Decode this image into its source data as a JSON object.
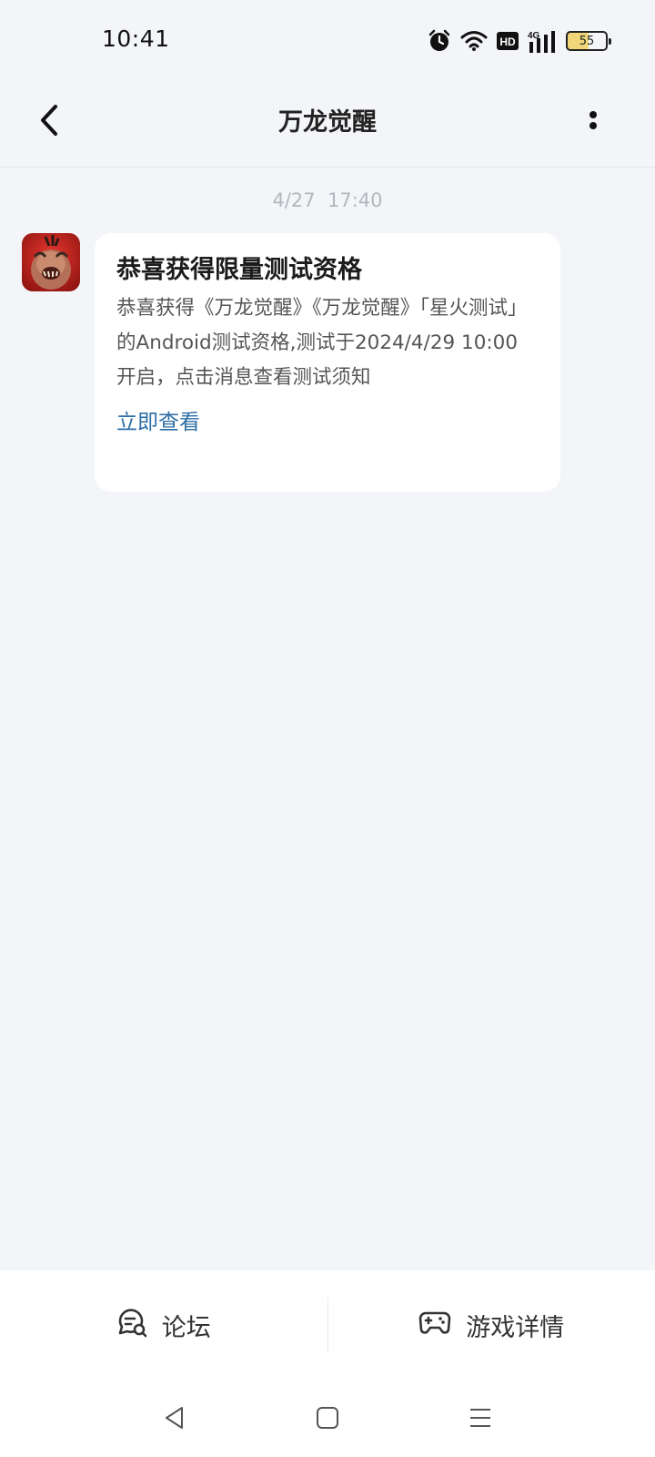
{
  "status_bar": {
    "time": "10:41",
    "battery_level": "55",
    "network_label": "4G",
    "hd_label": "HD",
    "icons": [
      "alarm-icon",
      "wifi-icon",
      "hd-icon",
      "signal-icon",
      "battery-icon"
    ]
  },
  "header": {
    "title": "万龙觉醒",
    "back_icon": "back-arrow-icon",
    "more_icon": "more-vertical-icon"
  },
  "message": {
    "timestamp": "4/27  17:40",
    "title": "恭喜获得限量测试资格",
    "body": "恭喜获得《万龙觉醒》《万龙觉醒》「星火测试」的Android测试资格,测试于2024/4/29 10:00 开启，点击消息查看测试须知",
    "link_label": "立即查看",
    "link_color": "#2d6ea6"
  },
  "bottom_bar": {
    "forum_label": "论坛",
    "forum_icon": "forum-chat-icon",
    "game_details_label": "游戏详情",
    "game_details_icon": "gamepad-icon"
  },
  "system_nav": {
    "icons": [
      "nav-back-icon",
      "nav-home-icon",
      "nav-menu-icon"
    ]
  },
  "colors": {
    "background": "#f3f5f8",
    "card": "#ffffff",
    "link": "#2d6ea6"
  }
}
